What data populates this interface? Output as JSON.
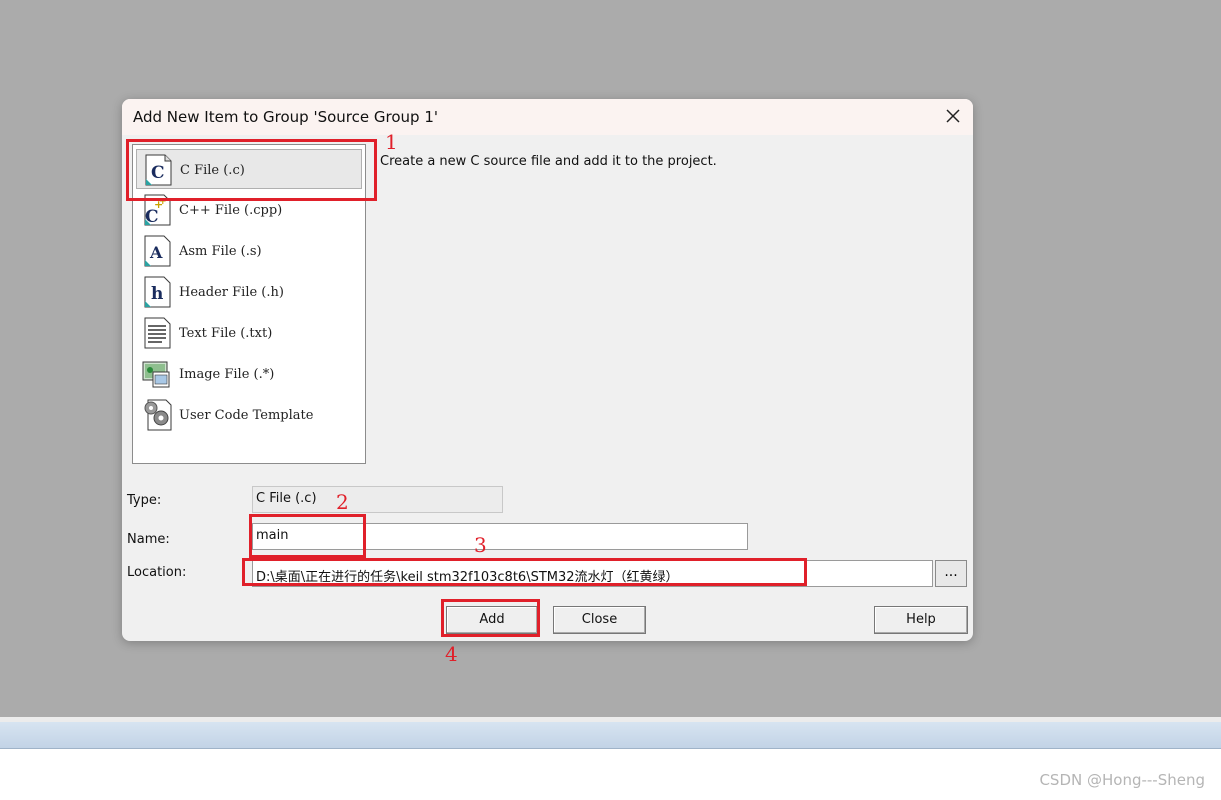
{
  "dialog": {
    "title": "Add New Item to Group 'Source Group 1'",
    "description": "Create a new C source file and add it to the project.",
    "file_types": [
      {
        "label": "C File (.c)",
        "icon": "c-file-icon",
        "selected": true
      },
      {
        "label": "C++ File (.cpp)",
        "icon": "cpp-file-icon",
        "selected": false
      },
      {
        "label": "Asm File (.s)",
        "icon": "asm-file-icon",
        "selected": false
      },
      {
        "label": "Header File (.h)",
        "icon": "header-file-icon",
        "selected": false
      },
      {
        "label": "Text File (.txt)",
        "icon": "text-file-icon",
        "selected": false
      },
      {
        "label": "Image File (.*)",
        "icon": "image-file-icon",
        "selected": false
      },
      {
        "label": "User Code Template",
        "icon": "user-code-template-icon",
        "selected": false
      }
    ],
    "form": {
      "type_label": "Type:",
      "type_value": "C File (.c)",
      "name_label": "Name:",
      "name_value": "main",
      "location_label": "Location:",
      "location_value": "D:\\桌面\\正在进行的任务\\keil stm32f103c8t6\\STM32流水灯（红黄绿）",
      "browse_label": "..."
    },
    "buttons": {
      "add": "Add",
      "close": "Close",
      "help": "Help"
    }
  },
  "annotations": [
    "1",
    "2",
    "3",
    "4"
  ],
  "watermark": "CSDN @Hong---Sheng",
  "colors": {
    "annotation_red": "#e0202a",
    "background": "#ababab",
    "dialog_bg": "#f0f0f0"
  }
}
